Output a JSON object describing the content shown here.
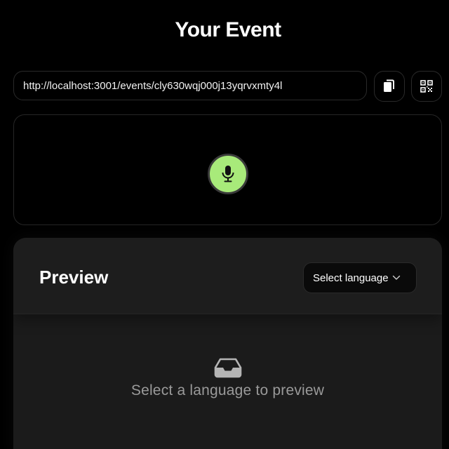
{
  "page": {
    "title": "Your Event"
  },
  "event_link": {
    "url": "http://localhost:3001/events/cly630wqj000j13yqrvxmty4l"
  },
  "icons": {
    "copy": "copy-icon",
    "qr": "qr-code-icon",
    "mic": "microphone-icon",
    "chevron": "chevron-down-icon",
    "inbox": "inbox-icon"
  },
  "colors": {
    "background": "#000000",
    "mic_accent": "#a8ea7a",
    "card": "#1b1b1b",
    "muted_text": "#9a9a9a"
  },
  "preview": {
    "title": "Preview",
    "language_select_label": "Select language",
    "empty_message": "Select a language to preview"
  }
}
